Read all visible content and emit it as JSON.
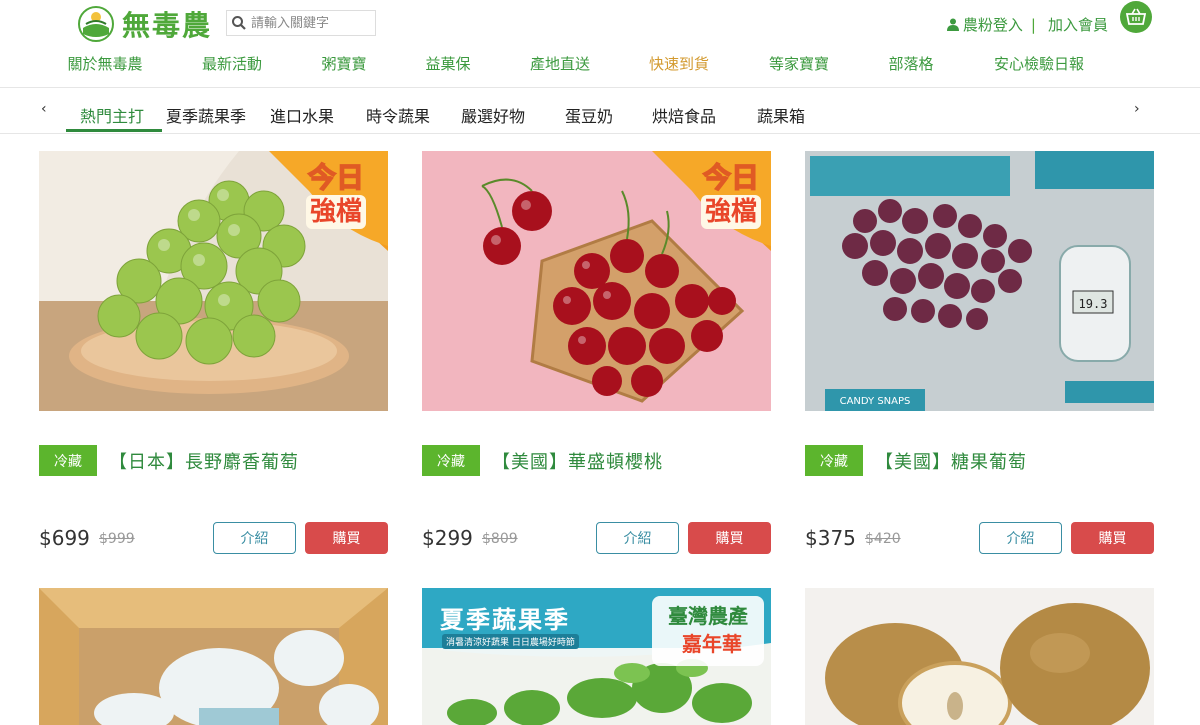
{
  "header": {
    "logo_text": "無毒農",
    "search_placeholder": "請輸入關鍵字",
    "login": "農粉登入",
    "separator": "|",
    "register": "加入會員"
  },
  "main_nav": [
    "關於無毒農",
    "最新活動",
    "粥寶寶",
    "益菓保",
    "產地直送",
    "快速到貨",
    "等家寶寶",
    "部落格",
    "安心檢驗日報"
  ],
  "main_nav_highlight_index": 5,
  "categories": {
    "prev": "‹",
    "next": "›",
    "items": [
      "熱門主打",
      "夏季蔬果季",
      "進口水果",
      "時令蔬果",
      "嚴選好物",
      "蛋豆奶",
      "烘焙食品",
      "蔬果箱"
    ],
    "active_index": 0
  },
  "promo_sticker": {
    "line1": "今日",
    "line2": "強檔"
  },
  "products": [
    {
      "badge": "冷藏",
      "name": "【日本】長野麝香葡萄",
      "price": "$699",
      "orig_price": "$999",
      "intro": "介紹",
      "buy": "購買"
    },
    {
      "badge": "冷藏",
      "name": "【美國】華盛頓櫻桃",
      "price": "$299",
      "orig_price": "$809",
      "intro": "介紹",
      "buy": "購買"
    },
    {
      "badge": "冷藏",
      "name": "【美國】糖果葡萄",
      "price": "$375",
      "orig_price": "$420",
      "intro": "介紹",
      "buy": "購買"
    }
  ],
  "grapes_label": {
    "brand": "CANDY SNAPS",
    "meter": "19.3"
  },
  "summer_banner": {
    "title": "夏季蔬果季",
    "sub": "消暑清涼好蔬果 日日農場好時節",
    "badge1": "臺灣農產",
    "badge2": "嘉年華"
  },
  "colors": {
    "green": "#4fa83a",
    "nav_green": "#3c9a3f",
    "gold": "#d39a2f",
    "badge_green": "#5cb52d",
    "buy_red": "#d84b4b",
    "intro_blue": "#3a8ea3"
  }
}
